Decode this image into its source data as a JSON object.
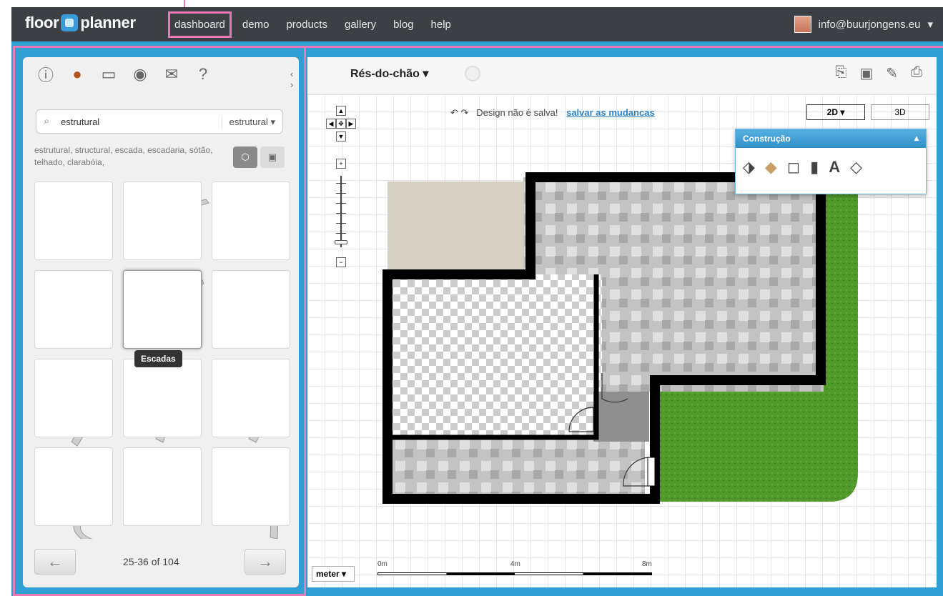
{
  "topbar": {
    "logo_left": "floor",
    "logo_right": "planner",
    "nav": [
      "dashboard",
      "demo",
      "products",
      "gallery",
      "blog",
      "help"
    ],
    "user_email": "info@buurjongens.eu"
  },
  "panel": {
    "search_value": "estrutural",
    "search_category": "estrutural",
    "tags": "estrutural, structural, escada, escadaria, sótão, telhado, clarabóia,",
    "tooltip": "Escadas",
    "pager_text": "25-36 of 104",
    "icons": [
      "info-icon",
      "furniture-icon",
      "picture-icon",
      "globe-icon",
      "mail-icon",
      "help-icon"
    ]
  },
  "canvas": {
    "floor_name": "Rés-do-chão",
    "status_text": "Design não é salva!",
    "save_link": "salvar as mudancas",
    "view_2d": "2D",
    "view_3d": "3D",
    "construction_title": "Construção",
    "unit": "meter",
    "scale_labels": [
      "0m",
      "4m",
      "8m"
    ]
  },
  "colors": {
    "topbar": "#3c4044",
    "accent": "#2f9fd3",
    "highlight": "#e879b2",
    "grass": "#4f9a2a",
    "wall": "#000000",
    "terrace": "#d6cfc4"
  }
}
